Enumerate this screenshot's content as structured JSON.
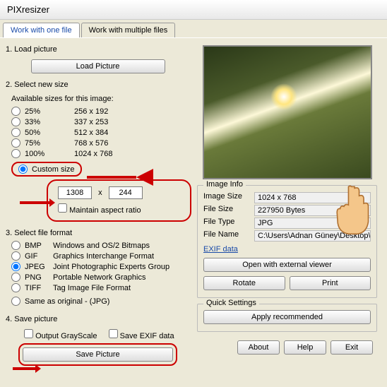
{
  "window": {
    "title": "PIXresizer"
  },
  "tabs": {
    "one": "Work with one file",
    "multi": "Work with multiple files"
  },
  "s1": {
    "title": "1. Load picture",
    "btn": "Load Picture"
  },
  "s2": {
    "title": "2. Select new size",
    "avail": "Available sizes for this image:",
    "rows": [
      {
        "pct": "25%",
        "dim": "256 x 192"
      },
      {
        "pct": "33%",
        "dim": "337 x 253"
      },
      {
        "pct": "50%",
        "dim": "512 x 384"
      },
      {
        "pct": "75%",
        "dim": "768 x 576"
      },
      {
        "pct": "100%",
        "dim": "1024 x 768"
      }
    ],
    "custom": "Custom size",
    "w": "1308",
    "x": "x",
    "h": "244",
    "ratio": "Maintain aspect ratio"
  },
  "s3": {
    "title": "3. Select file format",
    "rows": [
      {
        "c": "BMP",
        "d": "Windows and OS/2 Bitmaps"
      },
      {
        "c": "GIF",
        "d": "Graphics Interchange Format"
      },
      {
        "c": "JPEG",
        "d": "Joint Photographic Experts Group"
      },
      {
        "c": "PNG",
        "d": "Portable Network Graphics"
      },
      {
        "c": "TIFF",
        "d": "Tag Image File Format"
      }
    ],
    "same": "Same as original  - (JPG)"
  },
  "s4": {
    "title": "4. Save picture",
    "gray": "Output GrayScale",
    "exif": "Save EXIF data",
    "btn": "Save Picture"
  },
  "info": {
    "title": "Image Info",
    "rows": [
      {
        "k": "Image Size",
        "v": "1024 x 768"
      },
      {
        "k": "File Size",
        "v": "227950 Bytes"
      },
      {
        "k": "File Type",
        "v": "JPG"
      },
      {
        "k": "File Name",
        "v": "C:\\Users\\Adnan Güney\\Desktop\\ma"
      }
    ],
    "exif": "EXIF data",
    "open": "Open with external viewer",
    "rotate": "Rotate",
    "print": "Print"
  },
  "quick": {
    "title": "Quick Settings",
    "btn": "Apply recommended"
  },
  "footer": {
    "about": "About",
    "help": "Help",
    "exit": "Exit"
  }
}
